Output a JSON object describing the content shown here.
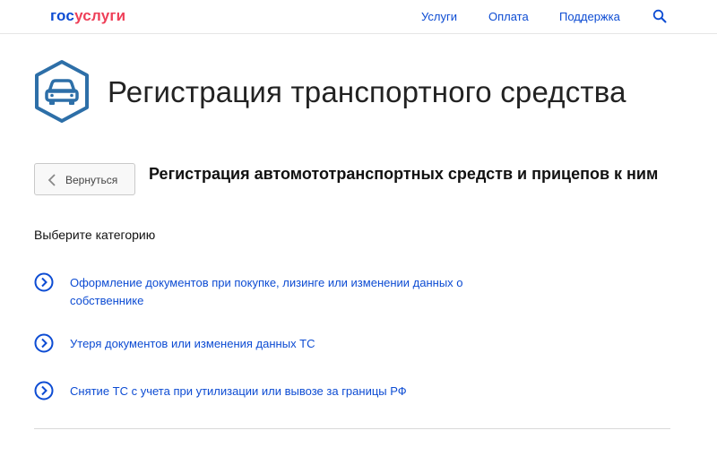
{
  "header": {
    "logo_part1": "гос",
    "logo_part2": "услуги",
    "nav": [
      "Услуги",
      "Оплата",
      "Поддержка"
    ],
    "search_icon": "search-icon"
  },
  "page": {
    "title": "Регистрация транспортного средства",
    "icon": "car-icon"
  },
  "back_button": {
    "label": "Вернуться"
  },
  "section": {
    "title": "Регистрация автомототранспортных средств и прицепов к ним",
    "category_heading": "Выберите категорию"
  },
  "categories": [
    {
      "label": "Оформление документов при покупке, лизинге или изменении данных о собственнике"
    },
    {
      "label": "Утеря документов или изменения данных ТС"
    },
    {
      "label": "Снятие ТС с учета при утилизации или вывозе за границы РФ"
    }
  ],
  "colors": {
    "brand_blue": "#0d4cd3",
    "brand_red": "#ee3f58",
    "icon_blue": "#2d6fa8"
  }
}
